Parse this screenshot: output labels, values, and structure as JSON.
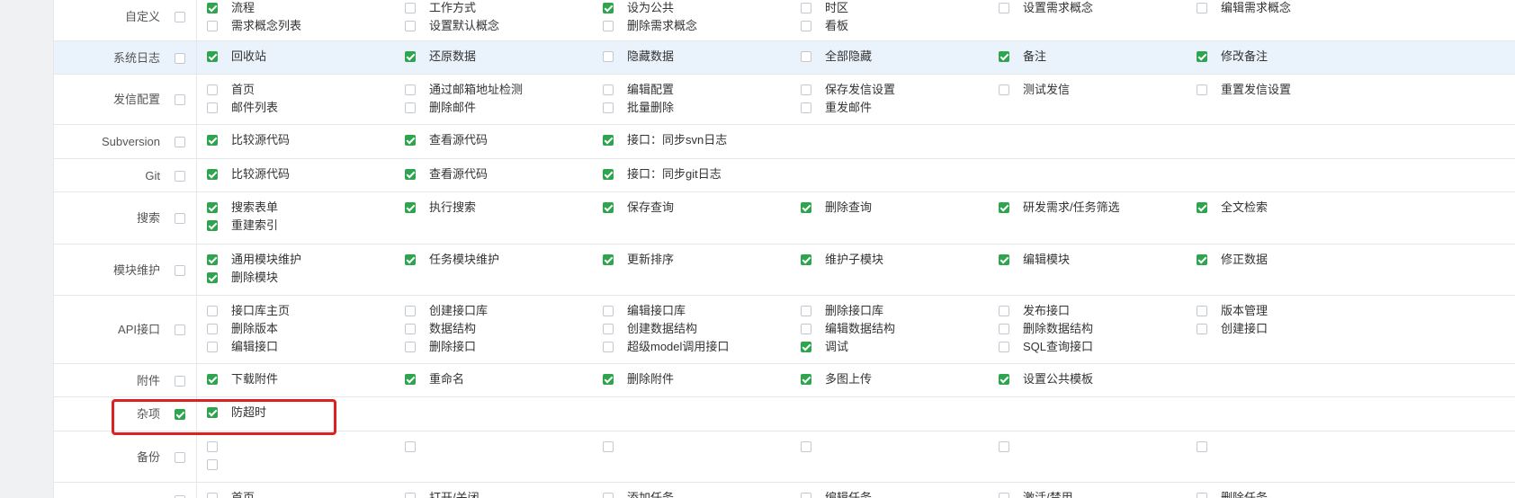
{
  "colors": {
    "checked": "#2ea44f",
    "highlight_row": "#eaf2fb",
    "annotation": "#e02020",
    "border": "#e4e7ec"
  },
  "rows": [
    {
      "label": "自定义",
      "checked": false,
      "options": [
        {
          "text": "流程",
          "checked": true
        },
        {
          "text": "工作方式",
          "checked": false
        },
        {
          "text": "设为公共",
          "checked": true
        },
        {
          "text": "时区",
          "checked": false
        },
        {
          "text": "设置需求概念",
          "checked": false
        },
        {
          "text": "编辑需求概念",
          "checked": false
        },
        {
          "text": "需求概念列表",
          "checked": false
        },
        {
          "text": "设置默认概念",
          "checked": false
        },
        {
          "text": "删除需求概念",
          "checked": false
        },
        {
          "text": "看板",
          "checked": false
        }
      ]
    },
    {
      "label": "系统日志",
      "checked": false,
      "highlight": true,
      "options": [
        {
          "text": "回收站",
          "checked": true
        },
        {
          "text": "还原数据",
          "checked": true
        },
        {
          "text": "隐藏数据",
          "checked": false
        },
        {
          "text": "全部隐藏",
          "checked": false
        },
        {
          "text": "备注",
          "checked": true
        },
        {
          "text": "修改备注",
          "checked": true
        }
      ]
    },
    {
      "label": "发信配置",
      "checked": false,
      "options": [
        {
          "text": "首页",
          "checked": false
        },
        {
          "text": "通过邮箱地址检测",
          "checked": false
        },
        {
          "text": "编辑配置",
          "checked": false
        },
        {
          "text": "保存发信设置",
          "checked": false
        },
        {
          "text": "测试发信",
          "checked": false
        },
        {
          "text": "重置发信设置",
          "checked": false
        },
        {
          "text": "邮件列表",
          "checked": false
        },
        {
          "text": "删除邮件",
          "checked": false
        },
        {
          "text": "批量删除",
          "checked": false
        },
        {
          "text": "重发邮件",
          "checked": false
        }
      ]
    },
    {
      "label": "Subversion",
      "checked": false,
      "options": [
        {
          "text": "比较源代码",
          "checked": true
        },
        {
          "text": "查看源代码",
          "checked": true
        },
        {
          "text": "接口：同步svn日志",
          "checked": true
        }
      ]
    },
    {
      "label": "Git",
      "checked": false,
      "options": [
        {
          "text": "比较源代码",
          "checked": true
        },
        {
          "text": "查看源代码",
          "checked": true
        },
        {
          "text": "接口：同步git日志",
          "checked": true
        }
      ]
    },
    {
      "label": "搜索",
      "checked": false,
      "options": [
        {
          "text": "搜索表单",
          "checked": true
        },
        {
          "text": "执行搜索",
          "checked": true
        },
        {
          "text": "保存查询",
          "checked": true
        },
        {
          "text": "删除查询",
          "checked": true
        },
        {
          "text": "研发需求/任务筛选",
          "checked": true
        },
        {
          "text": "全文检索",
          "checked": true
        },
        {
          "text": "重建索引",
          "checked": true
        }
      ]
    },
    {
      "label": "模块维护",
      "checked": false,
      "options": [
        {
          "text": "通用模块维护",
          "checked": true
        },
        {
          "text": "任务模块维护",
          "checked": true
        },
        {
          "text": "更新排序",
          "checked": true
        },
        {
          "text": "维护子模块",
          "checked": true
        },
        {
          "text": "编辑模块",
          "checked": true
        },
        {
          "text": "修正数据",
          "checked": true
        },
        {
          "text": "删除模块",
          "checked": true
        }
      ]
    },
    {
      "label": "API接口",
      "checked": false,
      "options": [
        {
          "text": "接口库主页",
          "checked": false
        },
        {
          "text": "创建接口库",
          "checked": false
        },
        {
          "text": "编辑接口库",
          "checked": false
        },
        {
          "text": "删除接口库",
          "checked": false
        },
        {
          "text": "发布接口",
          "checked": false
        },
        {
          "text": "版本管理",
          "checked": false
        },
        {
          "text": "删除版本",
          "checked": false
        },
        {
          "text": "数据结构",
          "checked": false
        },
        {
          "text": "创建数据结构",
          "checked": false
        },
        {
          "text": "编辑数据结构",
          "checked": false
        },
        {
          "text": "删除数据结构",
          "checked": false
        },
        {
          "text": "创建接口",
          "checked": false
        },
        {
          "text": "编辑接口",
          "checked": false
        },
        {
          "text": "删除接口",
          "checked": false
        },
        {
          "text": "超级model调用接口",
          "checked": false
        },
        {
          "text": "调试",
          "checked": true
        },
        {
          "text": "SQL查询接口",
          "checked": false
        }
      ]
    },
    {
      "label": "附件",
      "checked": false,
      "options": [
        {
          "text": "下载附件",
          "checked": true
        },
        {
          "text": "重命名",
          "checked": true
        },
        {
          "text": "删除附件",
          "checked": true
        },
        {
          "text": "多图上传",
          "checked": true
        },
        {
          "text": "设置公共模板",
          "checked": true
        }
      ]
    },
    {
      "label": "杂项",
      "checked": true,
      "options": [
        {
          "text": "防超时",
          "checked": true
        }
      ]
    },
    {
      "label": "备份",
      "checked": false,
      "options": [
        {
          "text": "",
          "checked": false
        },
        {
          "text": "",
          "checked": false
        },
        {
          "text": "",
          "checked": false
        },
        {
          "text": "",
          "checked": false
        },
        {
          "text": "",
          "checked": false
        },
        {
          "text": "",
          "checked": false
        },
        {
          "text": "",
          "checked": false
        }
      ]
    },
    {
      "label": "",
      "checked": false,
      "options": [
        {
          "text": "首页",
          "checked": false
        },
        {
          "text": "打开/关闭",
          "checked": false
        },
        {
          "text": "添加任务",
          "checked": false
        },
        {
          "text": "编辑任务",
          "checked": false
        },
        {
          "text": "激活/禁用",
          "checked": false
        },
        {
          "text": "删除任务",
          "checked": false
        }
      ]
    }
  ]
}
